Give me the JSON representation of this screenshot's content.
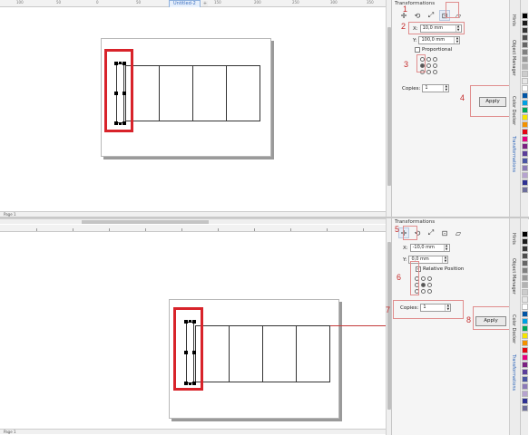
{
  "top": {
    "doc_tab": "Untitled-2",
    "ruler_numbers": [
      "100",
      "50",
      "0",
      "50",
      "100",
      "150",
      "200",
      "250",
      "300",
      "350"
    ],
    "docker_title": "Transformations",
    "x_label": "X:",
    "x_value": "10,0 mm",
    "y_label": "Y:",
    "y_value": "100,0 mm",
    "proportional_label": "Proportional",
    "copies_label": "Copies:",
    "copies_value": "1",
    "apply_label": "Apply",
    "tabs": [
      "Hints",
      "Object Manager",
      "Color Docker",
      "Transformations"
    ],
    "page_label": "Page 1"
  },
  "bottom": {
    "docker_title": "Transformations",
    "x_label": "X:",
    "x_value": "-10,0 mm",
    "y_label": "Y:",
    "y_value": "0,0 mm",
    "relative_label": "Relative Position",
    "copies_label": "Copies:",
    "copies_value": "1",
    "apply_label": "Apply",
    "tabs": [
      "Hints",
      "Object Manager",
      "Color Docker",
      "Transformations"
    ],
    "page_label": "Page 1"
  },
  "annotations": [
    "1",
    "2",
    "3",
    "4",
    "5",
    "6",
    "7",
    "8"
  ],
  "icons": {
    "position": "position-icon",
    "rotate": "rotate-icon",
    "scale": "scale-icon",
    "size": "size-icon",
    "skew": "skew-icon"
  },
  "palette_colors": [
    "#000000",
    "#1a1a1a",
    "#333333",
    "#4d4d4d",
    "#666666",
    "#808080",
    "#999999",
    "#b3b3b3",
    "#cccccc",
    "#e6e6e6",
    "#ffffff",
    "#0055a5",
    "#00a0e3",
    "#00a65a",
    "#f5e400",
    "#f39200",
    "#e30613",
    "#e6007e",
    "#7b2182",
    "#5b3e9a",
    "#4a56a3",
    "#8c7ab8",
    "#b6a3cf",
    "#2e3192",
    "#6d6e9b"
  ],
  "colors": {
    "highlight_red": "#d8232a",
    "annotation_red": "#c42b2b",
    "docker_bg": "#f5f5f5"
  }
}
